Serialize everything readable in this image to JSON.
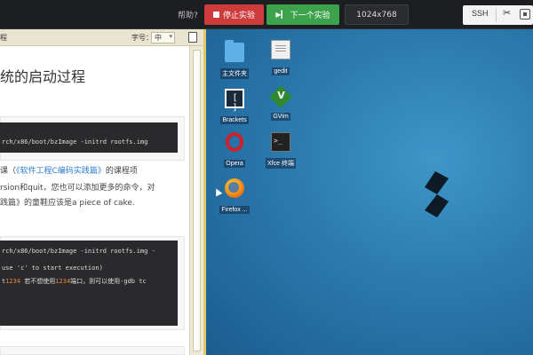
{
  "topbar": {
    "help_label": "帮助?",
    "stop_button": "停止实验",
    "next_button": "下一个实验",
    "resolution": "1024x768",
    "ssh_label": "SSH"
  },
  "doc": {
    "header_title": "程",
    "font_label": "字号：",
    "font_size_value": "中",
    "heading": "统的启动过程",
    "code1": "rch/x86/boot/bzImage -initrd rootfs.img",
    "para1_a": "课（",
    "para1_link": "《软件工程C编码实践篇》",
    "para1_b": "的课程项",
    "para2": "rsion和quit，您也可以添加更多的命令，对",
    "para3": "践篇》的童鞋应该是a piece of cake.",
    "code2_line1": "rch/x86/boot/bzImage -initrd rootfs.img -",
    "code2_line2": "use 'c' to start execution)",
    "code2_line3_a": "t",
    "code2_line3_hl1": "1234",
    "code2_line3_b": " 若不想使用",
    "code2_line3_hl2": "1234",
    "code2_line3_c": "端口，则可以使用-gdb tc"
  },
  "desktop": {
    "icons": [
      {
        "name": "home-folder",
        "label": "主文件夹"
      },
      {
        "name": "gedit",
        "label": "gedit"
      },
      {
        "name": "brackets",
        "label": "Brackets"
      },
      {
        "name": "gvim",
        "label": "GVim"
      },
      {
        "name": "opera",
        "label": "Opera"
      },
      {
        "name": "xfce-terminal",
        "label": "Xfce 终端"
      },
      {
        "name": "firefox",
        "label": "Firefox ..."
      }
    ]
  },
  "colors": {
    "stop": "#cf3b3b",
    "next": "#3ca24b",
    "divider": "#e1c766",
    "desktop": "#2b7aaf"
  }
}
